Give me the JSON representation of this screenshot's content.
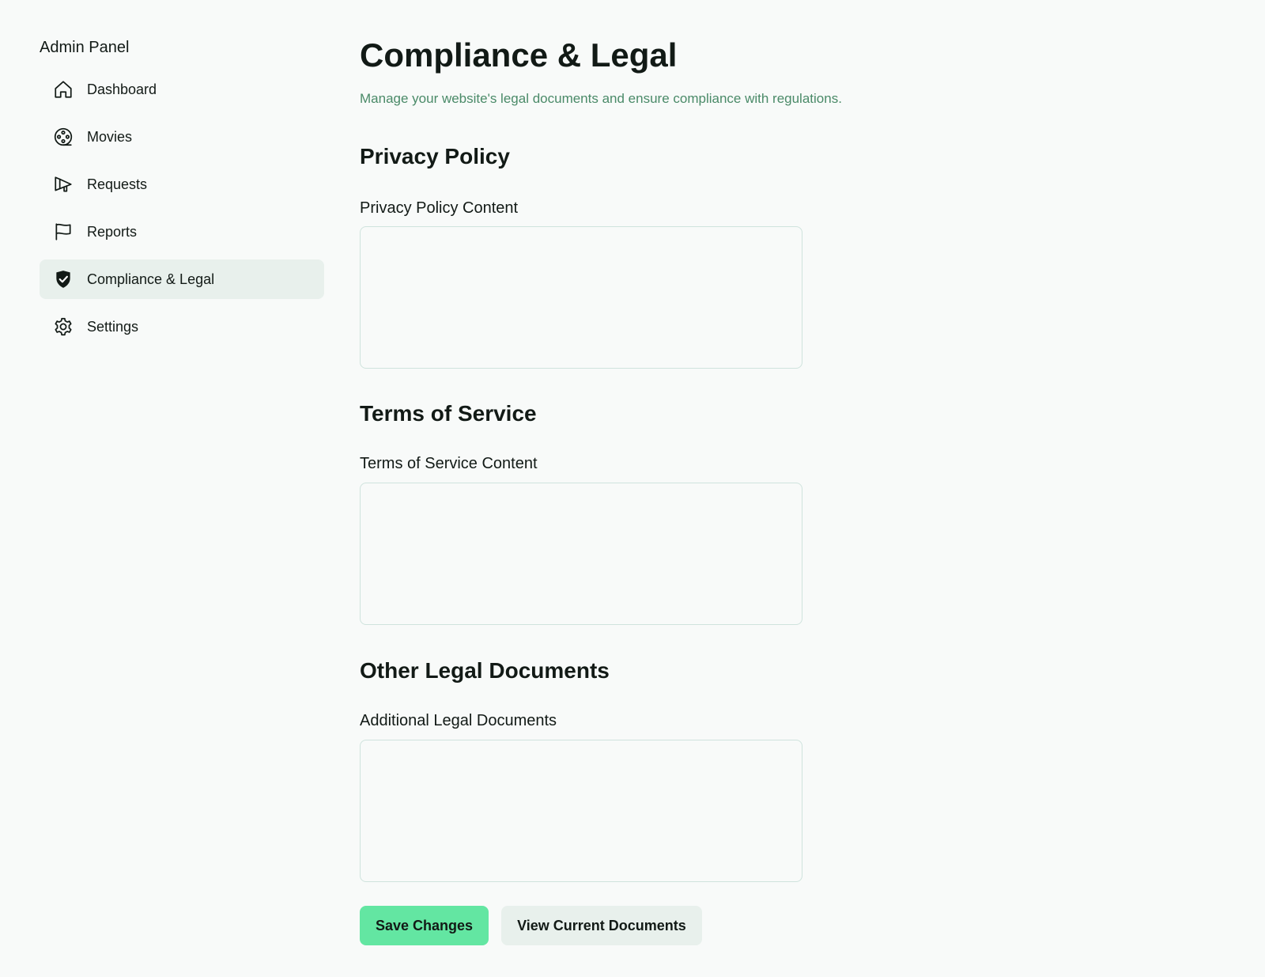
{
  "sidebar": {
    "title": "Admin Panel",
    "items": [
      {
        "label": "Dashboard",
        "icon": "home-icon",
        "active": false
      },
      {
        "label": "Movies",
        "icon": "film-reel-icon",
        "active": false
      },
      {
        "label": "Requests",
        "icon": "megaphone-icon",
        "active": false
      },
      {
        "label": "Reports",
        "icon": "flag-icon",
        "active": false
      },
      {
        "label": "Compliance & Legal",
        "icon": "shield-check-icon",
        "active": true
      },
      {
        "label": "Settings",
        "icon": "gear-icon",
        "active": false
      }
    ]
  },
  "main": {
    "title": "Compliance & Legal",
    "subtitle": "Manage your website's legal documents and ensure compliance with regulations.",
    "sections": [
      {
        "heading": "Privacy Policy",
        "label": "Privacy Policy Content",
        "value": ""
      },
      {
        "heading": "Terms of Service",
        "label": "Terms of Service Content",
        "value": ""
      },
      {
        "heading": "Other Legal Documents",
        "label": "Additional Legal Documents",
        "value": ""
      }
    ],
    "actions": {
      "save_label": "Save Changes",
      "view_label": "View Current Documents"
    }
  },
  "colors": {
    "background": "#f8faf9",
    "accent": "#63e6a2",
    "subtitle": "#4a8a68",
    "active_nav_bg": "#e8f0ec",
    "input_border": "#cfe3dd"
  }
}
